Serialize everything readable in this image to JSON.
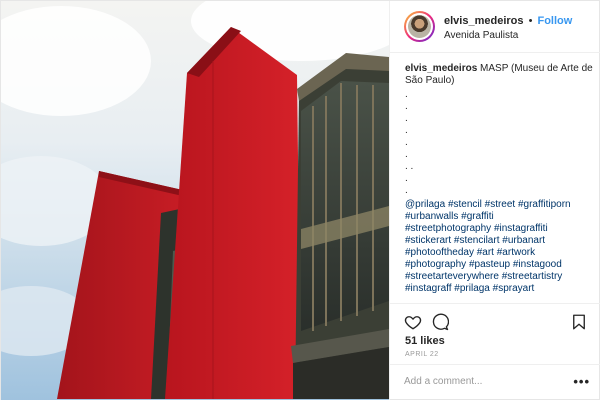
{
  "header": {
    "username": "elvis_medeiros",
    "separator": "•",
    "follow_label": "Follow",
    "location": "Avenida Paulista"
  },
  "caption": {
    "username": "elvis_medeiros",
    "text": "MASP (Museu de Arte de São Paulo)",
    "dot_lines": [
      ".",
      ".",
      ".",
      ".",
      ".",
      ".",
      ". .",
      ".",
      "."
    ],
    "hashtags": [
      "@prilaga #stencil #street #graffitiporn",
      "#urbanwalls #graffiti",
      "#streetphotography #instagraffiti",
      "#stickerart #stencilart #urbanart",
      "#photooftheday #art #artwork",
      "#photography #pasteup #instagood",
      "#streetarteverywhere #streetartistry",
      "#instagraff #prilaga #sprayart"
    ]
  },
  "actions": {
    "like_icon": "heart-icon",
    "comment_icon": "comment-icon",
    "save_icon": "bookmark-icon"
  },
  "likes": "51 likes",
  "date": "APRIL 22",
  "comment": {
    "placeholder": "Add a comment...",
    "more": "•••"
  },
  "colors": {
    "link": "#3897f0",
    "building_red": "#c41a22",
    "sky": "#a9c8e0"
  }
}
